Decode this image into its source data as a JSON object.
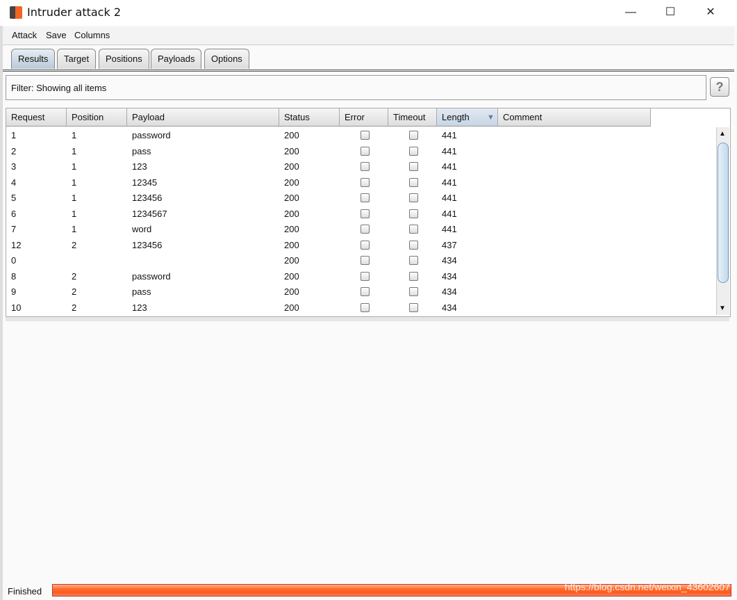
{
  "window": {
    "title": "Intruder attack 2",
    "minimize": "—",
    "maximize": "☐",
    "close": "✕"
  },
  "menu": [
    "Attack",
    "Save",
    "Columns"
  ],
  "tabs": [
    {
      "label": "Results",
      "active": true
    },
    {
      "label": "Target"
    },
    {
      "label": "Positions"
    },
    {
      "label": "Payloads"
    },
    {
      "label": "Options"
    }
  ],
  "filter": {
    "text": "Filter:  Showing all items",
    "help": "?"
  },
  "table": {
    "columns": [
      "Request",
      "Position",
      "Payload",
      "Status",
      "Error",
      "Timeout",
      "Length",
      "Comment"
    ],
    "sort_indicator": "▼",
    "rows": [
      [
        "1",
        "1",
        "password",
        "200",
        false,
        false,
        "441",
        ""
      ],
      [
        "2",
        "1",
        "pass",
        "200",
        false,
        false,
        "441",
        ""
      ],
      [
        "3",
        "1",
        "123",
        "200",
        false,
        false,
        "441",
        ""
      ],
      [
        "4",
        "1",
        "12345",
        "200",
        false,
        false,
        "441",
        ""
      ],
      [
        "5",
        "1",
        "123456",
        "200",
        false,
        false,
        "441",
        ""
      ],
      [
        "6",
        "1",
        "1234567",
        "200",
        false,
        false,
        "441",
        ""
      ],
      [
        "7",
        "1",
        "word",
        "200",
        false,
        false,
        "441",
        ""
      ],
      [
        "12",
        "2",
        "123456",
        "200",
        false,
        false,
        "437",
        ""
      ],
      [
        "0",
        "",
        "",
        "200",
        false,
        false,
        "434",
        ""
      ],
      [
        "8",
        "2",
        "password",
        "200",
        false,
        false,
        "434",
        ""
      ],
      [
        "9",
        "2",
        "pass",
        "200",
        false,
        false,
        "434",
        ""
      ],
      [
        "10",
        "2",
        "123",
        "200",
        false,
        false,
        "434",
        ""
      ]
    ]
  },
  "status": {
    "text": "Finished",
    "progress_percent": 100,
    "color": "#ff6a2a"
  },
  "watermark": "https://blog.csdn.net/weixin_43602607"
}
